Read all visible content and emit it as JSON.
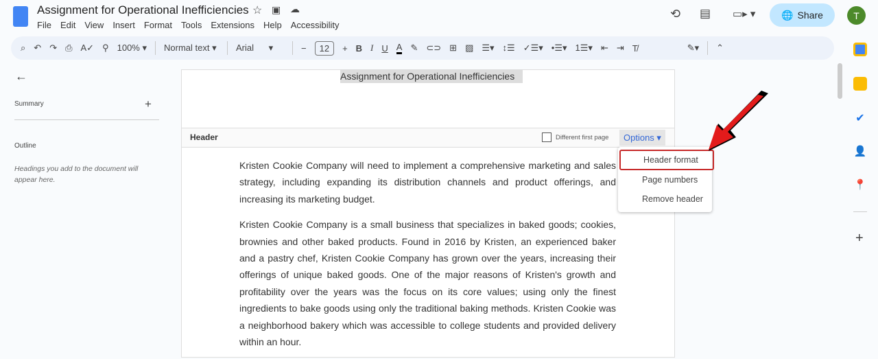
{
  "doc_title": "Assignment for Operational Inefficiencies",
  "menu": [
    "File",
    "Edit",
    "View",
    "Insert",
    "Format",
    "Tools",
    "Extensions",
    "Help",
    "Accessibility"
  ],
  "toolbar": {
    "zoom": "100%",
    "style": "Normal text",
    "font": "Arial",
    "font_size": "12"
  },
  "share_label": "Share",
  "avatar_initial": "T",
  "sidebar": {
    "summary": "Summary",
    "outline": "Outline",
    "outline_hint": "Headings you add to the document will appear here."
  },
  "header": {
    "text": "Assignment for Operational Inefficiencies",
    "label": "Header",
    "different_first_page": "Different first page",
    "options": "Options"
  },
  "options_menu": [
    "Header format",
    "Page numbers",
    "Remove header"
  ],
  "paragraphs": [
    "Kristen Cookie Company will need to implement a comprehensive marketing and sales strategy, including expanding its distribution channels and product offerings, and increasing its marketing budget.",
    "Kristen Cookie Company is a small business that specializes in baked goods; cookies, brownies and other baked products. Found in 2016 by Kristen, an experienced baker and a pastry chef, Kristen Cookie Company has grown over the years, increasing their offerings of unique baked goods. One of the major reasons of Kristen's growth and profitability over the years was the focus on its core values; using only the finest ingredients to bake goods using only the traditional baking methods. Kristen Cookie was a neighborhood bakery which was accessible to college students and provided delivery within an hour."
  ]
}
